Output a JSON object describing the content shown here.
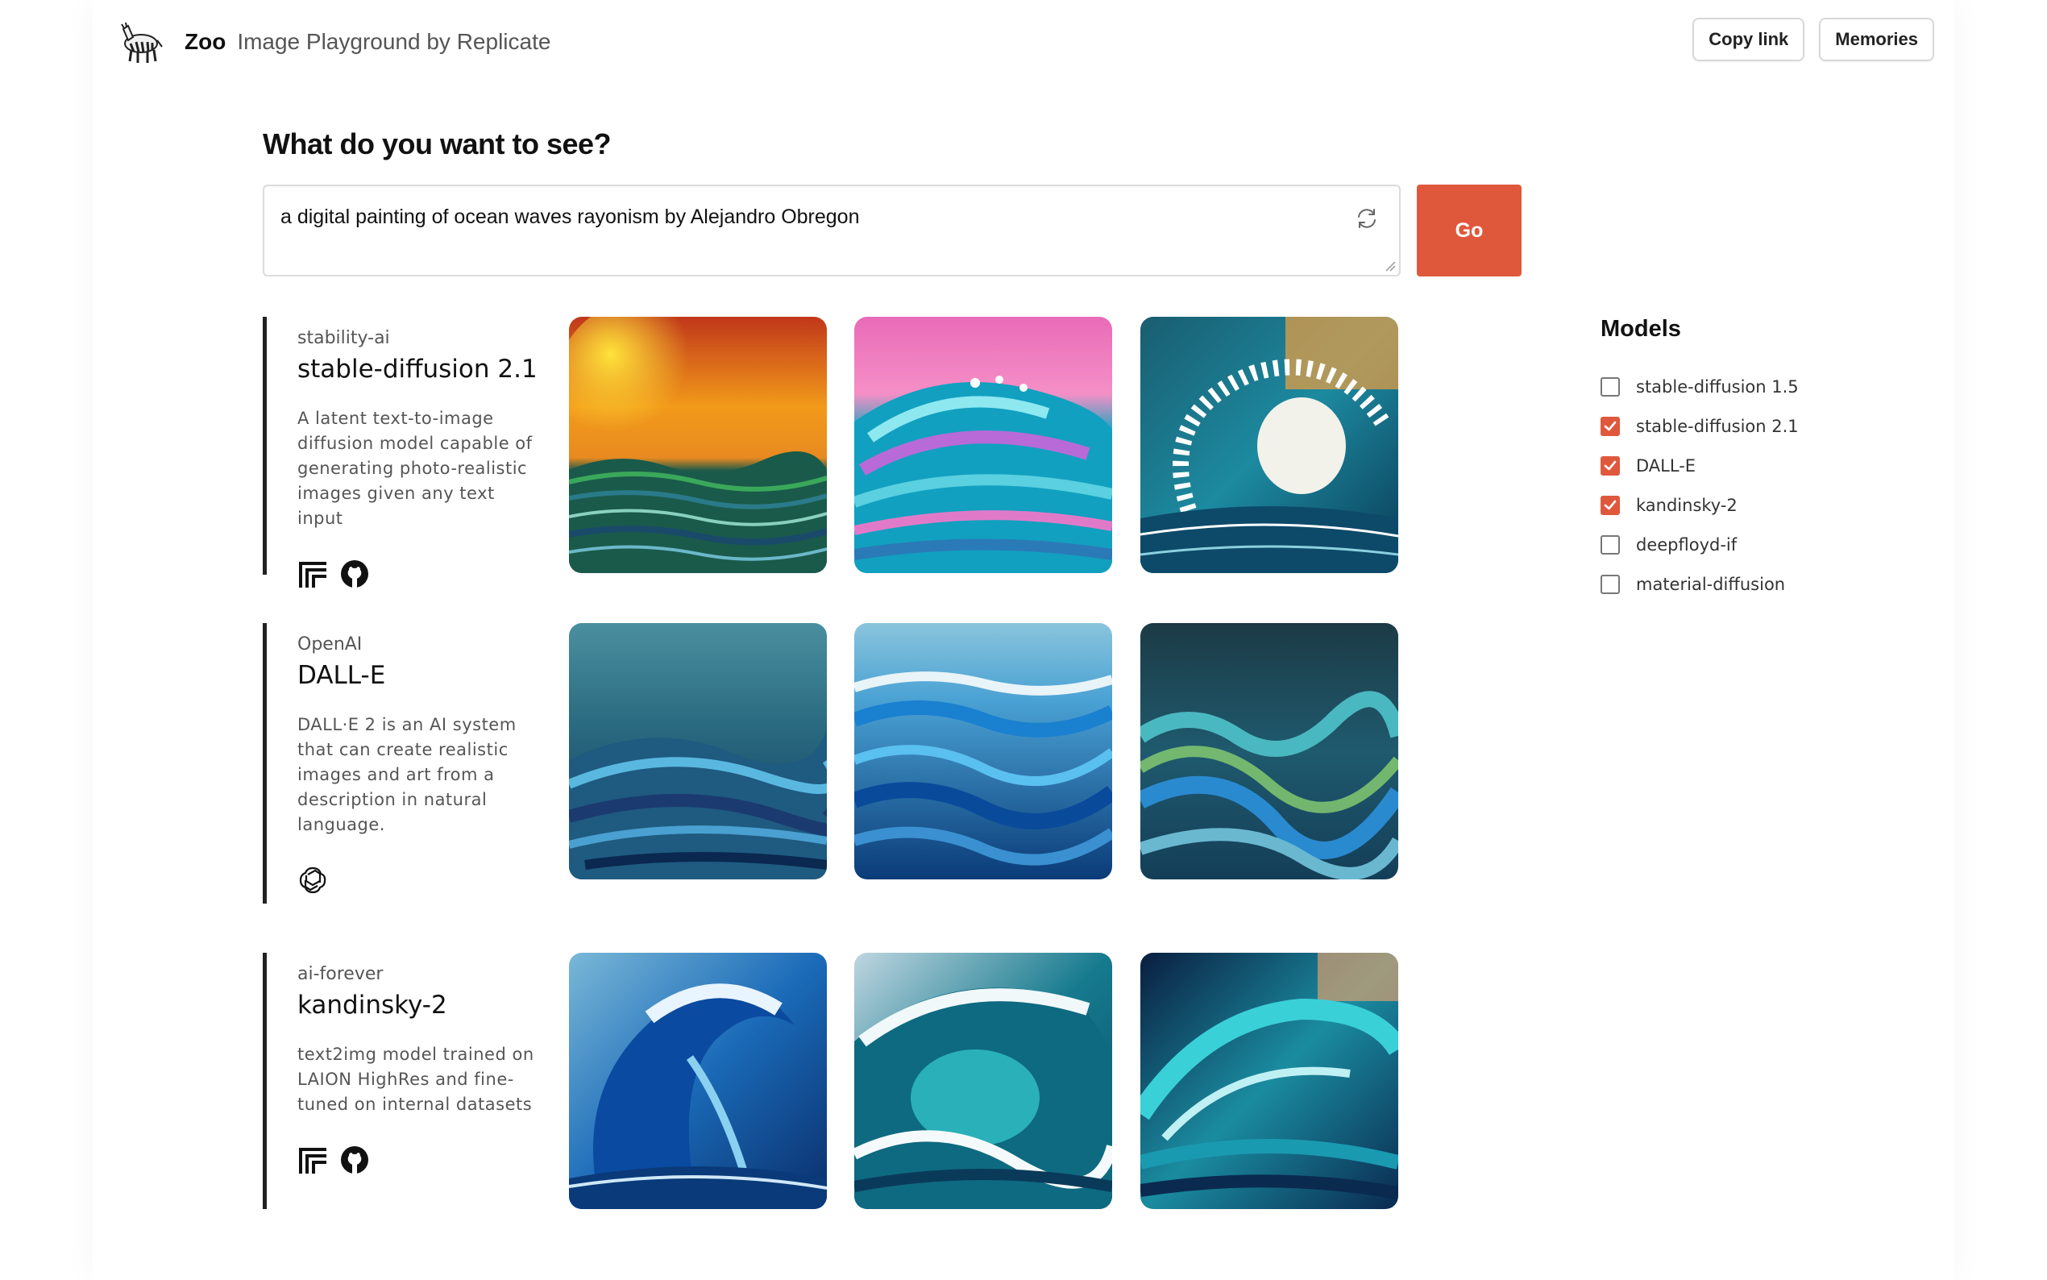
{
  "header": {
    "logo_icon": "zebra-icon",
    "brand": "Zoo",
    "tagline": "Image Playground by Replicate",
    "copy_link_label": "Copy link",
    "memories_label": "Memories"
  },
  "prompt": {
    "question": "What do you want to see?",
    "value": "a digital painting of ocean waves rayonism by Alejandro Obregon",
    "go_label": "Go"
  },
  "colors": {
    "accent": "#e0583c"
  },
  "models": [
    {
      "org": "stability-ai",
      "name": "stable-diffusion 2.1",
      "description": "A latent text-to-image diffusion model capable of generating photo-realistic images given any text input",
      "icons": [
        "replicate-icon",
        "github-icon"
      ]
    },
    {
      "org": "OpenAI",
      "name": "DALL-E",
      "description": "DALL·E 2 is an AI system that can create realistic images and art from a description in natural language.",
      "icons": [
        "openai-icon"
      ]
    },
    {
      "org": "ai-forever",
      "name": "kandinsky-2",
      "description": "text2img model trained on LAION HighRes and fine-tuned on internal datasets",
      "icons": [
        "replicate-icon",
        "github-icon"
      ]
    }
  ],
  "sidebar": {
    "title": "Models",
    "options": [
      {
        "label": "stable-diffusion 1.5",
        "checked": false
      },
      {
        "label": "stable-diffusion 2.1",
        "checked": true
      },
      {
        "label": "DALL-E",
        "checked": true
      },
      {
        "label": "kandinsky-2",
        "checked": true
      },
      {
        "label": "deepfloyd-if",
        "checked": false
      },
      {
        "label": "material-diffusion",
        "checked": false
      }
    ]
  }
}
